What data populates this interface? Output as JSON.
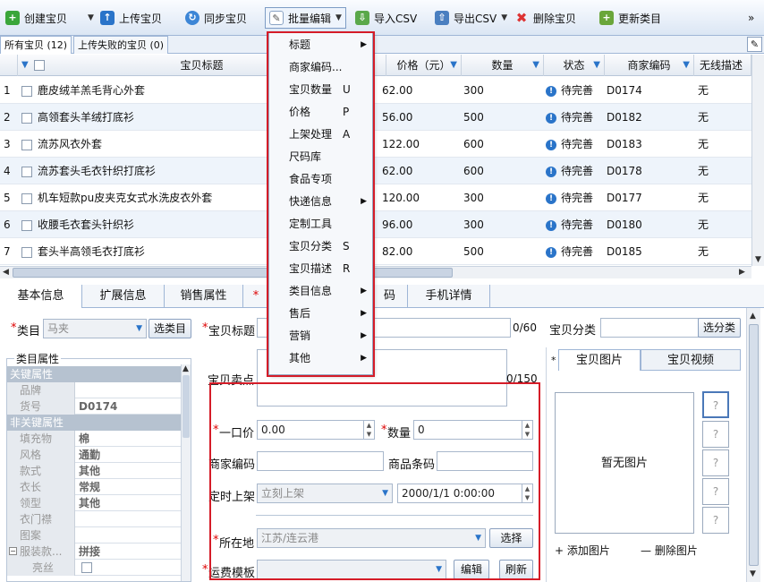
{
  "toolbar": {
    "create": "创建宝贝",
    "upload": "上传宝贝",
    "sync": "同步宝贝",
    "batch_edit": "批量编辑",
    "import_csv": "导入CSV",
    "export_csv": "导出CSV",
    "delete": "删除宝贝",
    "update_category": "更新类目",
    "more": "»"
  },
  "list_tabs": {
    "all": "所有宝贝 (12)",
    "failed": "上传失败的宝贝 (0)"
  },
  "grid": {
    "headers": {
      "title": "宝贝标题",
      "price": "价格（元）",
      "qty": "数量",
      "status": "状态",
      "code": "商家编码",
      "wireless": "无线描述"
    },
    "rows": [
      {
        "n": "1",
        "title": "鹿皮绒羊羔毛背心外套",
        "price": "62.00",
        "qty": "300",
        "status": "待完善",
        "code": "D0174",
        "wireless": "无"
      },
      {
        "n": "2",
        "title": "高领套头羊绒打底衫",
        "price": "56.00",
        "qty": "500",
        "status": "待完善",
        "code": "D0182",
        "wireless": "无"
      },
      {
        "n": "3",
        "title": "流苏风衣外套",
        "price": "122.00",
        "qty": "600",
        "status": "待完善",
        "code": "D0183",
        "wireless": "无"
      },
      {
        "n": "4",
        "title": "流苏套头毛衣针织打底衫",
        "price": "62.00",
        "qty": "600",
        "status": "待完善",
        "code": "D0178",
        "wireless": "无"
      },
      {
        "n": "5",
        "title": "机车短款pu皮夹克女式水洗皮衣外套",
        "price": "120.00",
        "qty": "300",
        "status": "待完善",
        "code": "D0177",
        "wireless": "无"
      },
      {
        "n": "6",
        "title": "收腰毛衣套头针织衫",
        "price": "96.00",
        "qty": "300",
        "status": "待完善",
        "code": "D0180",
        "wireless": "无"
      },
      {
        "n": "7",
        "title": "套头半高领毛衣打底衫",
        "price": "82.00",
        "qty": "500",
        "status": "待完善",
        "code": "D0185",
        "wireless": "无"
      }
    ]
  },
  "menu": [
    {
      "label": "标题",
      "shortcut": "",
      "sub": true
    },
    {
      "label": "商家编码...",
      "shortcut": "",
      "sub": false
    },
    {
      "label": "宝贝数量",
      "shortcut": "U",
      "sub": false
    },
    {
      "label": "价格",
      "shortcut": "P",
      "sub": false
    },
    {
      "label": "上架处理",
      "shortcut": "A",
      "sub": false
    },
    {
      "label": "尺码库",
      "shortcut": "",
      "sub": false
    },
    {
      "label": "食品专项",
      "shortcut": "",
      "sub": false
    },
    {
      "label": "快递信息",
      "shortcut": "",
      "sub": true
    },
    {
      "label": "定制工具",
      "shortcut": "",
      "sub": false
    },
    {
      "label": "宝贝分类",
      "shortcut": "S",
      "sub": false
    },
    {
      "label": "宝贝描述",
      "shortcut": "R",
      "sub": false
    },
    {
      "label": "类目信息",
      "shortcut": "",
      "sub": true
    },
    {
      "label": "售后",
      "shortcut": "",
      "sub": true
    },
    {
      "label": "营销",
      "shortcut": "",
      "sub": true
    },
    {
      "label": "其他",
      "shortcut": "",
      "sub": true
    }
  ],
  "detail_tabs": {
    "basic": "基本信息",
    "ext": "扩展信息",
    "sale": "销售属性",
    "code_partial": "码",
    "mobile": "手机详情"
  },
  "form": {
    "req": "*",
    "category_label": "类目",
    "category_value": "马夹",
    "select_category": "选类目",
    "title_label": "宝贝标题",
    "title_count": "0/60",
    "shop_cat_label": "宝贝分类",
    "select_shop_cat": "选分类",
    "selling_label": "宝贝卖点",
    "selling_count": "0/150",
    "price_label": "一口价",
    "price_value": "0.00",
    "qty_label": "数量",
    "qty_value": "0",
    "code_label": "商家编码",
    "barcode_label": "商品条码",
    "listing_label": "定时上架",
    "listing_value": "立刻上架",
    "listing_time": "2000/1/1 0:00:00",
    "location_label": "所在地",
    "location_value": "江苏/连云港",
    "choose": "选择",
    "shipping_label": "运费模板",
    "edit": "编辑",
    "refresh": "刷新"
  },
  "props": {
    "legend": "类目属性",
    "key_section": "关键属性",
    "nonkey_section": "非关键属性",
    "rows_key": [
      {
        "k": "品牌",
        "v": ""
      },
      {
        "k": "货号",
        "v": "D0174"
      }
    ],
    "rows_nonkey": [
      {
        "k": "填充物",
        "v": "棉"
      },
      {
        "k": "风格",
        "v": "通勤"
      },
      {
        "k": "款式",
        "v": "其他"
      },
      {
        "k": "衣长",
        "v": "常规"
      },
      {
        "k": "领型",
        "v": "其他"
      },
      {
        "k": "衣门襟",
        "v": ""
      },
      {
        "k": "图案",
        "v": ""
      }
    ],
    "group_label": "服装款...",
    "group_value": "拼接",
    "sub_item": "亮丝"
  },
  "pictures": {
    "tab_pics": "宝贝图片",
    "tab_video": "宝贝视频",
    "empty": "暂无图片",
    "add": "+ 添加图片",
    "remove": "— 删除图片",
    "placeholder": "?"
  },
  "colors": {
    "highlight": "#d51c28",
    "accent": "#2a74c9"
  }
}
